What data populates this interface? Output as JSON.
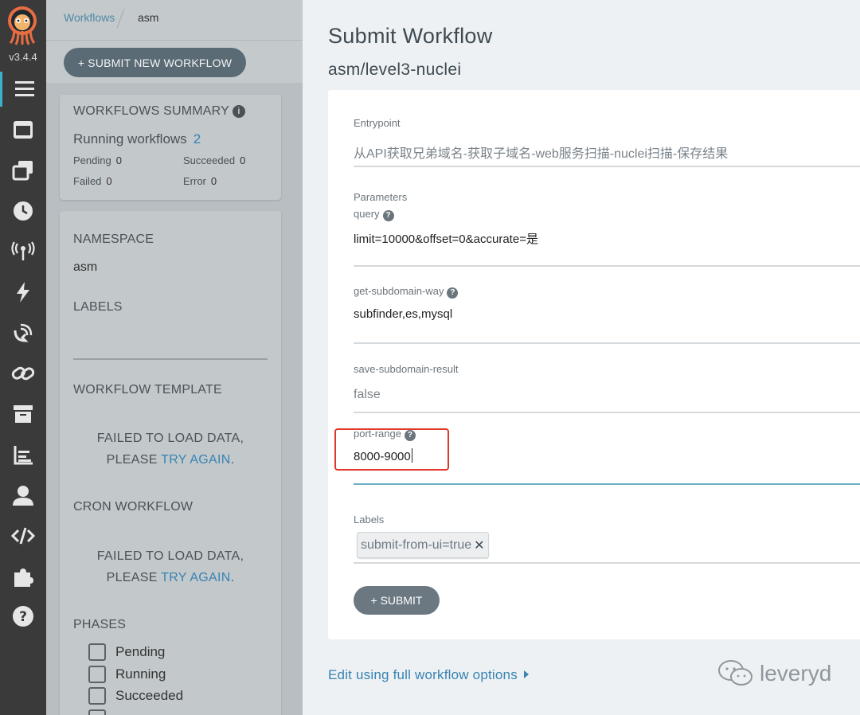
{
  "app": {
    "version": "v3.4.4"
  },
  "nav": [
    "workflows-nav",
    "templates-nav",
    "cluster-templates-nav",
    "cron-nav",
    "event-sources-nav",
    "sensors-nav",
    "event-flow-nav",
    "links-nav",
    "archive-nav",
    "reports-nav",
    "user-nav",
    "api-docs-nav",
    "plugins-nav",
    "help-nav"
  ],
  "breadcrumb": {
    "link": "Workflows",
    "current": "asm"
  },
  "toolbar": {
    "submit_new": "+ SUBMIT NEW WORKFLOW"
  },
  "summary": {
    "title": "WORKFLOWS SUMMARY",
    "running_label": "Running workflows",
    "running_count": "2",
    "pending_label": "Pending",
    "pending_count": "0",
    "succeeded_label": "Succeeded",
    "succeeded_count": "0",
    "failed_label": "Failed",
    "failed_count": "0",
    "error_label": "Error",
    "error_count": "0"
  },
  "filters": {
    "namespace_title": "NAMESPACE",
    "namespace_value": "asm",
    "labels_title": "LABELS",
    "template_title": "WORKFLOW TEMPLATE",
    "cron_title": "CRON WORKFLOW",
    "fail_line1": "FAILED TO LOAD DATA,",
    "fail_prefix": "PLEASE ",
    "fail_link": "TRY AGAIN",
    "fail_suffix": ".",
    "phases_title": "PHASES",
    "phases": [
      "Pending",
      "Running",
      "Succeeded"
    ]
  },
  "form": {
    "title": "Submit Workflow",
    "subtitle": "asm/level3-nuclei",
    "entrypoint_label": "Entrypoint",
    "entrypoint_value": "从API获取兄弟域名-获取子域名-web服务扫描-nuclei扫描-保存结果",
    "parameters_label": "Parameters",
    "params": {
      "query_label": "query",
      "query_value": "limit=10000&offset=0&accurate=是",
      "gsw_label": "get-subdomain-way",
      "gsw_value": "subfinder,es,mysql",
      "ssr_label": "save-subdomain-result",
      "ssr_value": "false",
      "port_label": "port-range",
      "port_value": "8000-9000"
    },
    "labels_label": "Labels",
    "label_tag": "submit-from-ui=true",
    "submit": "+ SUBMIT",
    "edit_link": "Edit using full workflow options"
  },
  "watermark": "leveryd"
}
